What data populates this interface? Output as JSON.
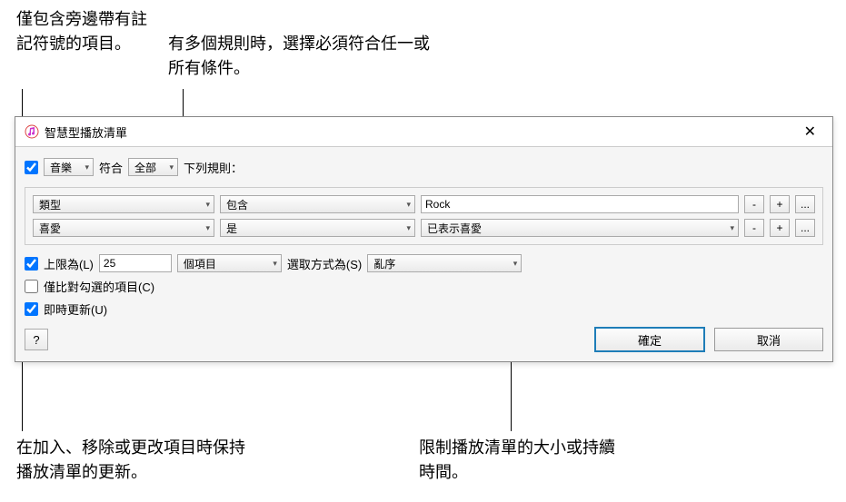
{
  "callouts": {
    "topLeft": "僅包含旁邊帶有註記符號的項目。",
    "topRight": "有多個規則時，選擇必須符合任一或所有條件。",
    "bottomLeft": "在加入、移除或更改項目時保持播放清單的更新。",
    "bottomRight": "限制播放清單的大小或持續時間。"
  },
  "dialog": {
    "title": "智慧型播放清單",
    "closeGlyph": "✕",
    "firstRow": {
      "mediaType": "音樂",
      "matchLabel": "符合",
      "matchScope": "全部",
      "rulesSuffix": "下列規則："
    },
    "rules": [
      {
        "field": "類型",
        "op": "包含",
        "valueType": "text",
        "value": "Rock"
      },
      {
        "field": "喜愛",
        "op": "是",
        "valueType": "select",
        "value": "已表示喜愛"
      }
    ],
    "ruleButtons": {
      "remove": "-",
      "add": "+",
      "more": "..."
    },
    "limit": {
      "label": "上限為(L)",
      "value": "25",
      "unit": "個項目",
      "selectByLabel": "選取方式為(S)",
      "selectBy": "亂序"
    },
    "matchChecked": {
      "label": "僅比對勾選的項目(C)"
    },
    "liveUpdate": {
      "label": "即時更新(U)"
    },
    "helpGlyph": "?",
    "buttons": {
      "ok": "確定",
      "cancel": "取消"
    }
  }
}
